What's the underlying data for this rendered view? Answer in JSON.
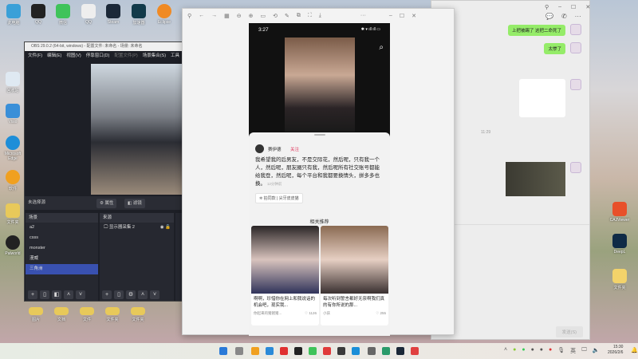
{
  "desktop": {
    "icons_top": [
      "此电脑",
      "QQ",
      "微信",
      "QQ",
      "Steam",
      "加速器",
      "Eclipse"
    ],
    "icons_left": [
      "回收站",
      "Visio",
      "Microsoft Edge",
      "软件",
      "文件夹",
      "Palworld"
    ],
    "icons_right": [
      "CAJViewer",
      "DeepL",
      "文件夹"
    ],
    "icons_bottom": [
      "图片",
      "文档",
      "文件",
      "文件夹",
      "文件夹"
    ]
  },
  "obs": {
    "title": "OBS 29.0.2 (64-bit, windows) - 配置文件: 未命名 - 场景: 未命名",
    "menu": [
      "文件(F)",
      "编辑(E)",
      "视图(V)",
      "停靠窗口(D)",
      "配置文件(P)",
      "场景集合(S)",
      "工具"
    ],
    "no_source": "未选择源",
    "properties": "属性",
    "filters": "滤镜",
    "scenes_header": "场景",
    "scenes": [
      "a2",
      "csss",
      "monster",
      "漫威",
      "三角洲"
    ],
    "selected_scene": "三角洲",
    "sources_header": "来源",
    "sources": [
      "显示器采集 2"
    ]
  },
  "viewer": {
    "toolbar_more": "···"
  },
  "phone": {
    "time": "3:27",
    "author": "赛伊德",
    "follow": "关注",
    "post": "我希望我的后男友，不是交际花，然后呢，只有我一个人，然后呢，朋友圈只有我，然后呢所有社交账号都能给我登，然后呢，每个平台和我都要换情头，拼多多也换。",
    "time_ago": "12分钟前",
    "tag": "拍同款 | 尖牙皮皮猫",
    "related": "相关推荐",
    "cards": [
      {
        "caption": "啊啊，珍惜你在网上和我说话的机会吧，现实我...",
        "author": "你起来的猪猪猪...",
        "likes": "1126"
      },
      {
        "caption": "每次听到誓言都好无奈啊我们真的有你所说的那...",
        "author": "小孩",
        "likes": "255"
      }
    ]
  },
  "wechat": {
    "messages": [
      "上把被踢了 这把二命死了",
      "太惨了"
    ],
    "timestamp": "11:29",
    "send": "发送(S)"
  },
  "taskbar": {
    "time": "15:30",
    "date": "2026/2/6"
  }
}
